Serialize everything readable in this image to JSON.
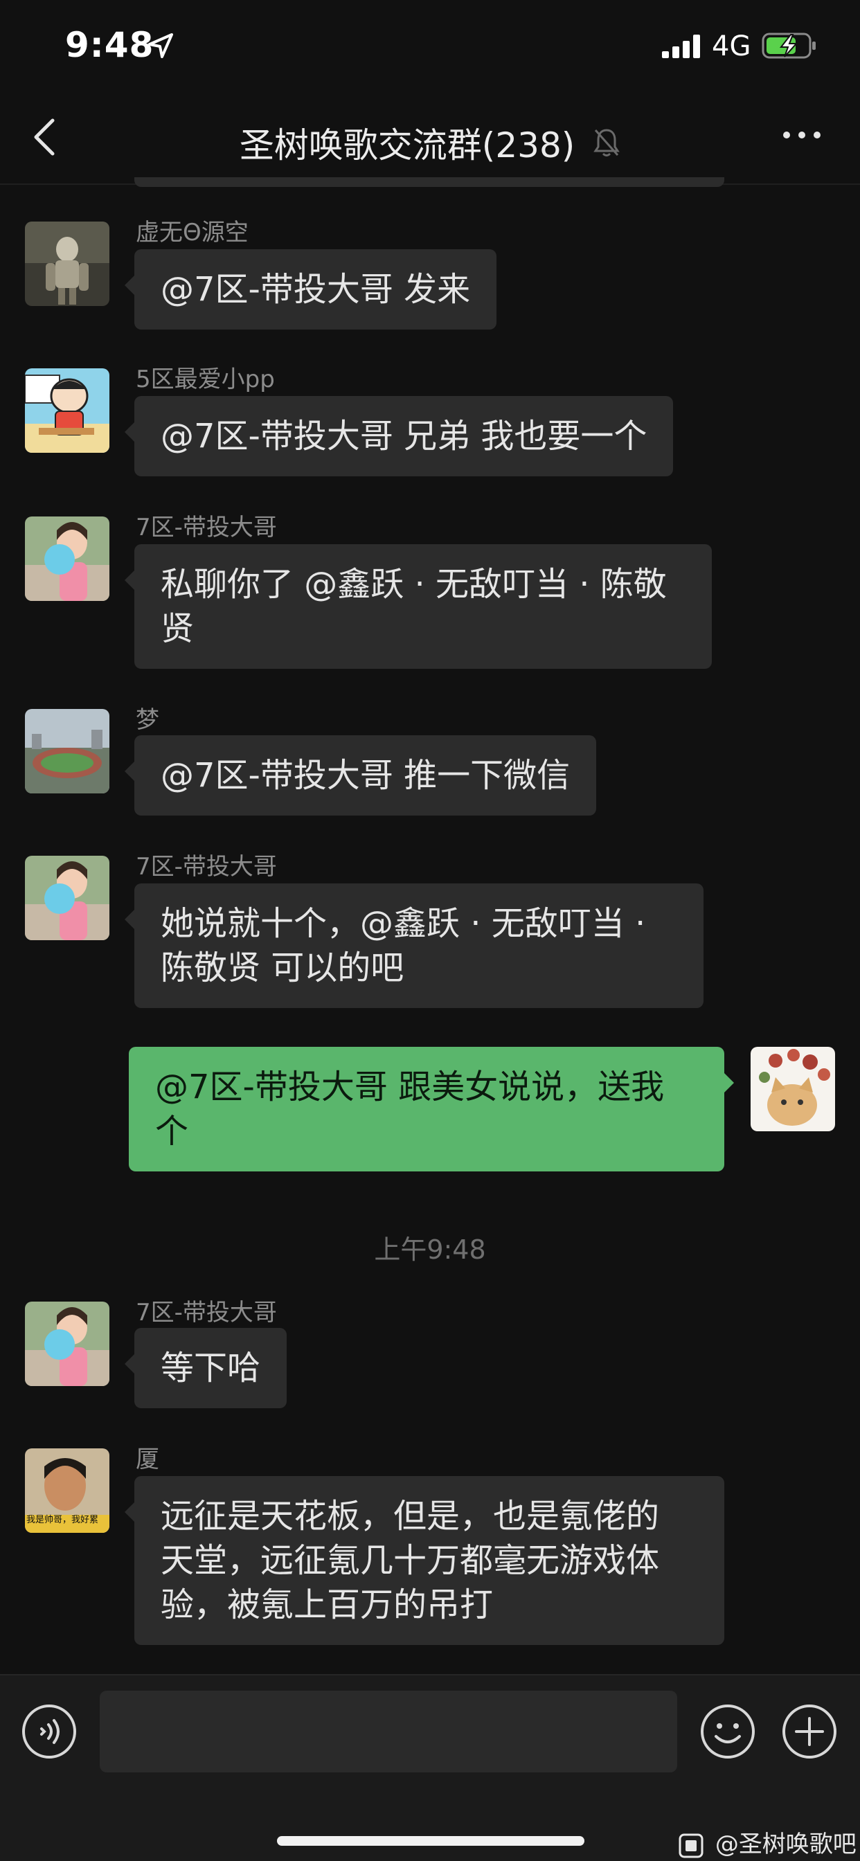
{
  "status_bar": {
    "time": "9:48",
    "network": "4G",
    "icons": [
      "location-arrow-icon",
      "signal-bars-icon",
      "battery-charging-icon"
    ]
  },
  "nav": {
    "title": "圣树唤歌交流群(238)",
    "icons": [
      "back-chevron-icon",
      "mute-bell-icon",
      "more-dots-icon"
    ]
  },
  "messages": [
    {
      "sender": "虚无Θ源空",
      "lines": [
        "@7区-带投大哥 发来"
      ]
    },
    {
      "sender": "5区最爱小pp",
      "lines": [
        "@7区-带投大哥 兄弟 我也要一个"
      ]
    },
    {
      "sender": "7区-带投大哥",
      "lines": [
        "私聊你了 @鑫跃 · 无敌叮当 · 陈敬",
        "贤"
      ]
    },
    {
      "sender": "梦",
      "lines": [
        "@7区-带投大哥 推一下微信"
      ]
    },
    {
      "sender": "7区-带投大哥",
      "lines": [
        "她说就十个，@鑫跃 · 无敌叮当 ·",
        "陈敬贤 可以的吧"
      ]
    },
    {
      "sender": "",
      "lines": [
        "@7区-带投大哥 跟美女说说，送我",
        "个"
      ],
      "mine": true
    },
    {
      "sender": "7区-带投大哥",
      "lines": [
        "等下哈"
      ]
    },
    {
      "sender": "厦",
      "lines": [
        "远征是天花板，但是，也是氪佬的",
        "天堂，远征氪几十万都毫无游戏体",
        "验，被氪上百万的吊打"
      ]
    }
  ],
  "timestamp": "上午9:48",
  "avatar_captions": {
    "xia": "我是帅哥，我好累"
  },
  "input_bar": {
    "placeholder": "",
    "icons": [
      "voice-icon",
      "emoji-icon",
      "plus-icon"
    ]
  },
  "watermark": {
    "text": "@圣树唤歌吧",
    "icon": "tieba-paste-icon"
  },
  "colors": {
    "background": "#111111",
    "incoming_bubble": "#2c2c2c",
    "outgoing_bubble": "#5ab66c",
    "sender_text": "#8c8c8c"
  }
}
